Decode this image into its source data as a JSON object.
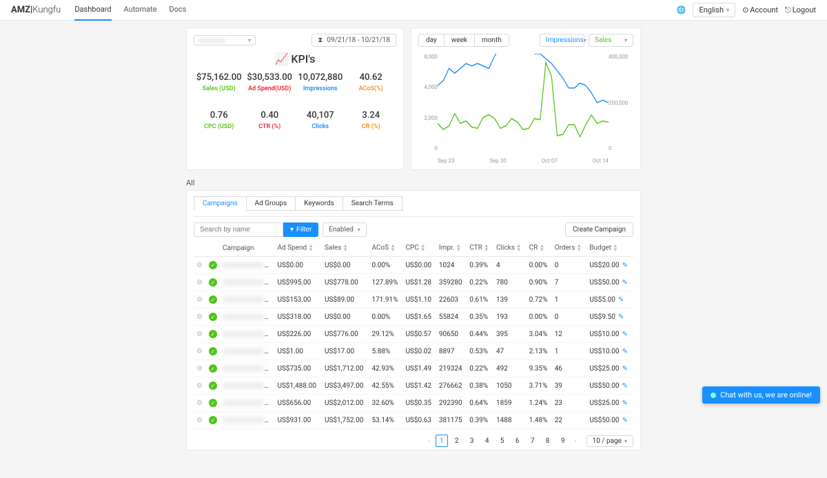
{
  "header": {
    "logo_bold": "AMZ",
    "logo_sep": "|",
    "logo_thin": "Kungfu",
    "nav": [
      "Dashboard",
      "Automate",
      "Docs"
    ],
    "activeNav": 0,
    "language": "English",
    "account": "Account",
    "logout": "Logout"
  },
  "kpi": {
    "date_range": "09/21/18 - 10/21/18",
    "title": "KPI's",
    "items": [
      {
        "value": "$75,162.00",
        "label": "Sales (USD)",
        "cls": "lbl-green"
      },
      {
        "value": "$30,533.00",
        "label": "Ad Spend(USD)",
        "cls": "lbl-red"
      },
      {
        "value": "10,072,880",
        "label": "Impressions",
        "cls": "lbl-blue"
      },
      {
        "value": "40.62",
        "label": "ACoS(%)",
        "cls": "lbl-orange"
      },
      {
        "value": "0.76",
        "label": "CPC (USD)",
        "cls": "lbl-green"
      },
      {
        "value": "0.40",
        "label": "CTR (%)",
        "cls": "lbl-red"
      },
      {
        "value": "40,107",
        "label": "Clicks",
        "cls": "lbl-blue"
      },
      {
        "value": "3.24",
        "label": "CR (%)",
        "cls": "lbl-orange"
      }
    ]
  },
  "chart": {
    "toggles": [
      "day",
      "week",
      "month"
    ],
    "series1": "Impressions",
    "series2": "Sales",
    "y_left": [
      "8,000",
      "4,000",
      "2,000",
      "0"
    ],
    "y_right": [
      "400,000",
      "200,000",
      "0"
    ],
    "x_labels": [
      "Sep 23",
      "Sep 30",
      "Oct 07",
      "Oct 14"
    ]
  },
  "chart_data": {
    "type": "line",
    "x_label_dates": [
      "Sep 23",
      "Sep 30",
      "Oct 07",
      "Oct 14"
    ],
    "y_left_axis": {
      "label": "",
      "min": 0,
      "max": 8000
    },
    "y_right_axis": {
      "label": "",
      "min": 0,
      "max": 400000
    },
    "series": [
      {
        "name": "Impressions",
        "axis": "right",
        "color": "#1890ff",
        "values": [
          270000,
          290000,
          340000,
          320000,
          340000,
          360000,
          350000,
          360000,
          350000,
          340000,
          390000,
          430000,
          450000,
          440000,
          440000,
          430000,
          420000,
          400000,
          400000,
          380000,
          360000,
          330000,
          300000,
          260000,
          260000,
          280000,
          270000,
          240000,
          200000,
          210000,
          200000
        ]
      },
      {
        "name": "Sales",
        "axis": "left",
        "color": "#52c41a",
        "values": [
          2300,
          1800,
          2100,
          3100,
          2300,
          2500,
          2000,
          1900,
          2800,
          3000,
          2700,
          1900,
          2100,
          2700,
          2400,
          1800,
          1900,
          2700,
          2600,
          7300,
          6100,
          1300,
          1400,
          2200,
          2200,
          1200,
          2200,
          3000,
          2300,
          2500,
          2400
        ]
      }
    ]
  },
  "table": {
    "all": "All",
    "tabs": [
      "Campaigns",
      "Ad Groups",
      "Keywords",
      "Search Terms"
    ],
    "activeTab": 0,
    "search_placeholder": "Search by name",
    "filter": "Filter",
    "enabled": "Enabled",
    "create": "Create Campaign",
    "columns": [
      "Campaign",
      "Ad Spend",
      "Sales",
      "ACoS",
      "CPC",
      "Impr.",
      "CTR",
      "Clicks",
      "CR",
      "Orders",
      "Budget"
    ],
    "rows": [
      [
        "US$0.00",
        "US$0.00",
        "0.00%",
        "US$0.00",
        "1024",
        "0.39%",
        "4",
        "0.00%",
        "0",
        "US$20.00"
      ],
      [
        "US$995.00",
        "US$778.00",
        "127.89%",
        "US$1.28",
        "359280",
        "0.22%",
        "780",
        "0.90%",
        "7",
        "US$50.00"
      ],
      [
        "US$153.00",
        "US$89.00",
        "171.91%",
        "US$1.10",
        "22603",
        "0.61%",
        "139",
        "0.72%",
        "1",
        "US$5.00"
      ],
      [
        "US$318.00",
        "US$0.00",
        "0.00%",
        "US$1.65",
        "55824",
        "0.35%",
        "193",
        "0.00%",
        "0",
        "US$9.50"
      ],
      [
        "US$226.00",
        "US$776.00",
        "29.12%",
        "US$0.57",
        "90650",
        "0.44%",
        "395",
        "3.04%",
        "12",
        "US$10.00"
      ],
      [
        "US$1.00",
        "US$17.00",
        "5.88%",
        "US$0.02",
        "8897",
        "0.53%",
        "47",
        "2.13%",
        "1",
        "US$10.00"
      ],
      [
        "US$735.00",
        "US$1,712.00",
        "42.93%",
        "US$1.49",
        "219324",
        "0.22%",
        "492",
        "9.35%",
        "46",
        "US$25.00"
      ],
      [
        "US$1,488.00",
        "US$3,497.00",
        "42.55%",
        "US$1.42",
        "276662",
        "0.38%",
        "1050",
        "3.71%",
        "39",
        "US$50.00"
      ],
      [
        "US$656.00",
        "US$2,012.00",
        "32.60%",
        "US$0.35",
        "292390",
        "0.64%",
        "1859",
        "1.24%",
        "23",
        "US$25.00"
      ],
      [
        "US$931.00",
        "US$1,752.00",
        "53.14%",
        "US$0.63",
        "381175",
        "0.39%",
        "1488",
        "1.48%",
        "22",
        "US$50.00"
      ]
    ],
    "pages": [
      "1",
      "2",
      "3",
      "4",
      "5",
      "6",
      "7",
      "8",
      "9"
    ],
    "page_size": "10 / page"
  },
  "chat": "Chat with us, we are online!"
}
